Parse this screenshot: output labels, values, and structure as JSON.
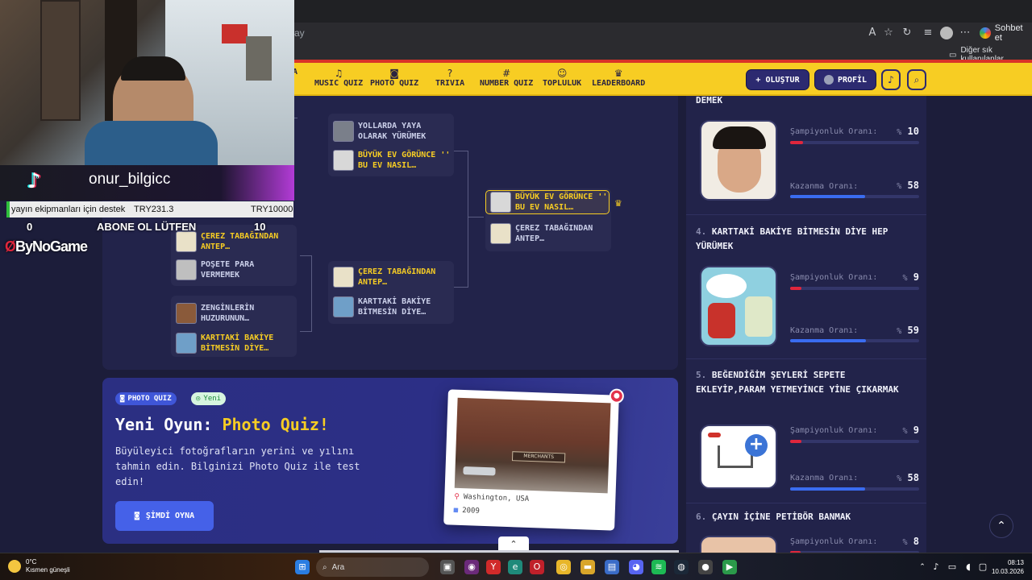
{
  "browser": {
    "url_fragment": "ay",
    "chat_label": "Sohbet et",
    "bookmarks_folder": "Diğer sık kullanılanlar"
  },
  "nav": {
    "items": [
      {
        "label": "A",
        "icon": "partial-icon"
      },
      {
        "label": "MUSIC QUIZ",
        "icon": "music-note-icon"
      },
      {
        "label": "PHOTO QUIZ",
        "icon": "camera-icon"
      },
      {
        "label": "TRIVIA",
        "icon": "question-icon"
      },
      {
        "label": "NUMBER QUIZ",
        "icon": "hash-icon"
      },
      {
        "label": "TOPLULUK",
        "icon": "users-icon"
      },
      {
        "label": "LEADERBOARD",
        "icon": "trophy-icon"
      }
    ],
    "create_label": "+ OLUŞTUR",
    "profile_label": "PROFİL"
  },
  "bracket": {
    "col1": [
      {
        "label": "ÇEREZ TABAĞINDAN ANTEP…",
        "winner": true
      },
      {
        "label": "POŞETE PARA VERMEMEK",
        "winner": false
      },
      {
        "label": "ZENGİNLERİN HUZURUNUN…",
        "winner": false
      },
      {
        "label": "KARTTAKİ BAKİYE BİTMESİN DİYE…",
        "winner": true
      }
    ],
    "col2": [
      {
        "label": "YOLLARDA YAYA OLARAK YÜRÜMEK",
        "winner": false
      },
      {
        "label": "BÜYÜK EV GÖRÜNCE '' BU EV NASIL…",
        "winner": true
      },
      {
        "label": "ÇEREZ TABAĞINDAN ANTEP…",
        "winner": true
      },
      {
        "label": "KARTTAKİ BAKİYE BİTMESİN DİYE…",
        "winner": false
      }
    ],
    "final": [
      {
        "label": "BÜYÜK EV GÖRÜNCE '' BU EV NASIL…",
        "winner": true
      },
      {
        "label": "ÇEREZ TABAĞINDAN ANTEP…",
        "winner": false
      }
    ]
  },
  "promo": {
    "badge_type": "PHOTO QUIZ",
    "badge_new": "Yeni",
    "title_prefix": "Yeni Oyun: ",
    "title_highlight": "Photo Quiz!",
    "description": "Büyüleyici fotoğrafların yerini ve yılını tahmin edin. Bilginizi Photo Quiz ile test edin!",
    "play_label": "ŞİMDİ OYNA",
    "photo_location": "Washington, USA",
    "photo_year": "2009"
  },
  "leaderboard": {
    "entries": [
      {
        "num": "",
        "title": "DEMEK",
        "champ_label": "Şampiyonluk Oranı:",
        "champ": 10,
        "win_label": "Kazanma Oranı:",
        "win": 58
      },
      {
        "num": "4.",
        "title": "KARTTAKİ BAKİYE BİTMESİN DİYE HEP YÜRÜMEK",
        "champ_label": "Şampiyonluk Oranı:",
        "champ": 9,
        "win_label": "Kazanma Oranı:",
        "win": 59
      },
      {
        "num": "5.",
        "title": "BEĞENDİĞİM ŞEYLERİ SEPETE EKLEYİP,PARAM YETMEYİNCE YİNE ÇIKARMAK",
        "champ_label": "Şampiyonluk Oranı:",
        "champ": 9,
        "win_label": "Kazanma Oranı:",
        "win": 58
      },
      {
        "num": "6.",
        "title": "ÇAYIN İÇİNE PETİBÖR BANMAK",
        "champ_label": "Şampiyonluk Oranı:",
        "champ": 8
      }
    ],
    "percent_sign": "%",
    "colors": {
      "champ": "#e0263c",
      "win": "#3a6cf0"
    }
  },
  "stream": {
    "username": "onur_bilgicc",
    "goal_text": "yayın ekipmanları için destek",
    "goal_current": "TRY231.3",
    "goal_target": "TRY10000",
    "count_left": "0",
    "cta": "ABONE OL LÜTFEN",
    "count_right": "10",
    "sponsor": "ByNoGame"
  },
  "taskbar": {
    "temp": "0°C",
    "weather": "Kısmen güneşli",
    "search": "Ara",
    "time": "08:13",
    "date": "10.03.2026"
  }
}
